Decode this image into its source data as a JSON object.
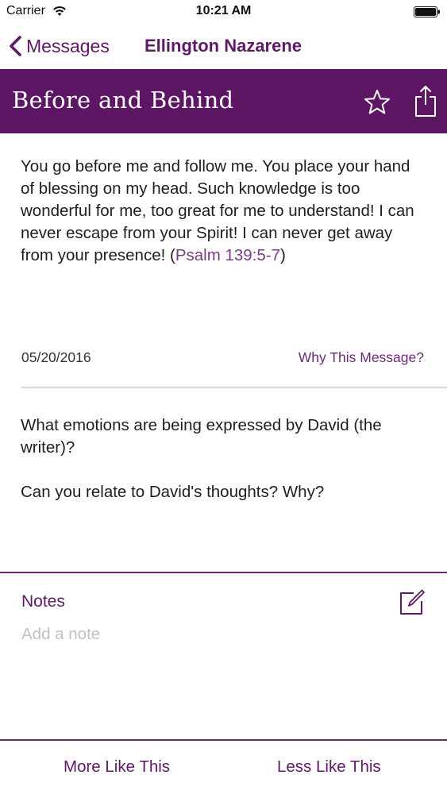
{
  "status_bar": {
    "carrier": "Carrier",
    "time": "10:21 AM",
    "wifi_icon": "wifi-icon",
    "battery_icon": "battery-icon"
  },
  "nav": {
    "back_label": "Messages",
    "title": "Ellington Nazarene"
  },
  "header": {
    "title": "Before and Behind",
    "star_icon": "star-icon",
    "share_icon": "share-icon"
  },
  "message": {
    "verse_text": "You go before me and follow me. You place your hand of blessing on my head. Such knowledge is too wonderful for me, too great for me to understand!  I can never escape from your Spirit! I can never get away from your presence! (",
    "verse_reference": "Psalm 139:5-7",
    "verse_close": ")",
    "date": "05/20/2016",
    "why_link": "Why This Message?"
  },
  "questions": [
    "What emotions are being expressed by David (the writer)?",
    "Can you relate to David's thoughts? Why?"
  ],
  "notes": {
    "label": "Notes",
    "placeholder": "Add a note",
    "value": "",
    "edit_icon": "compose-icon"
  },
  "footer": {
    "more_label": "More Like This",
    "less_label": "Less Like This"
  },
  "colors": {
    "brand_purple": "#5d1664",
    "link_purple": "#7b3a86",
    "background": "#ffffff",
    "placeholder_gray": "#c2c2c2"
  }
}
